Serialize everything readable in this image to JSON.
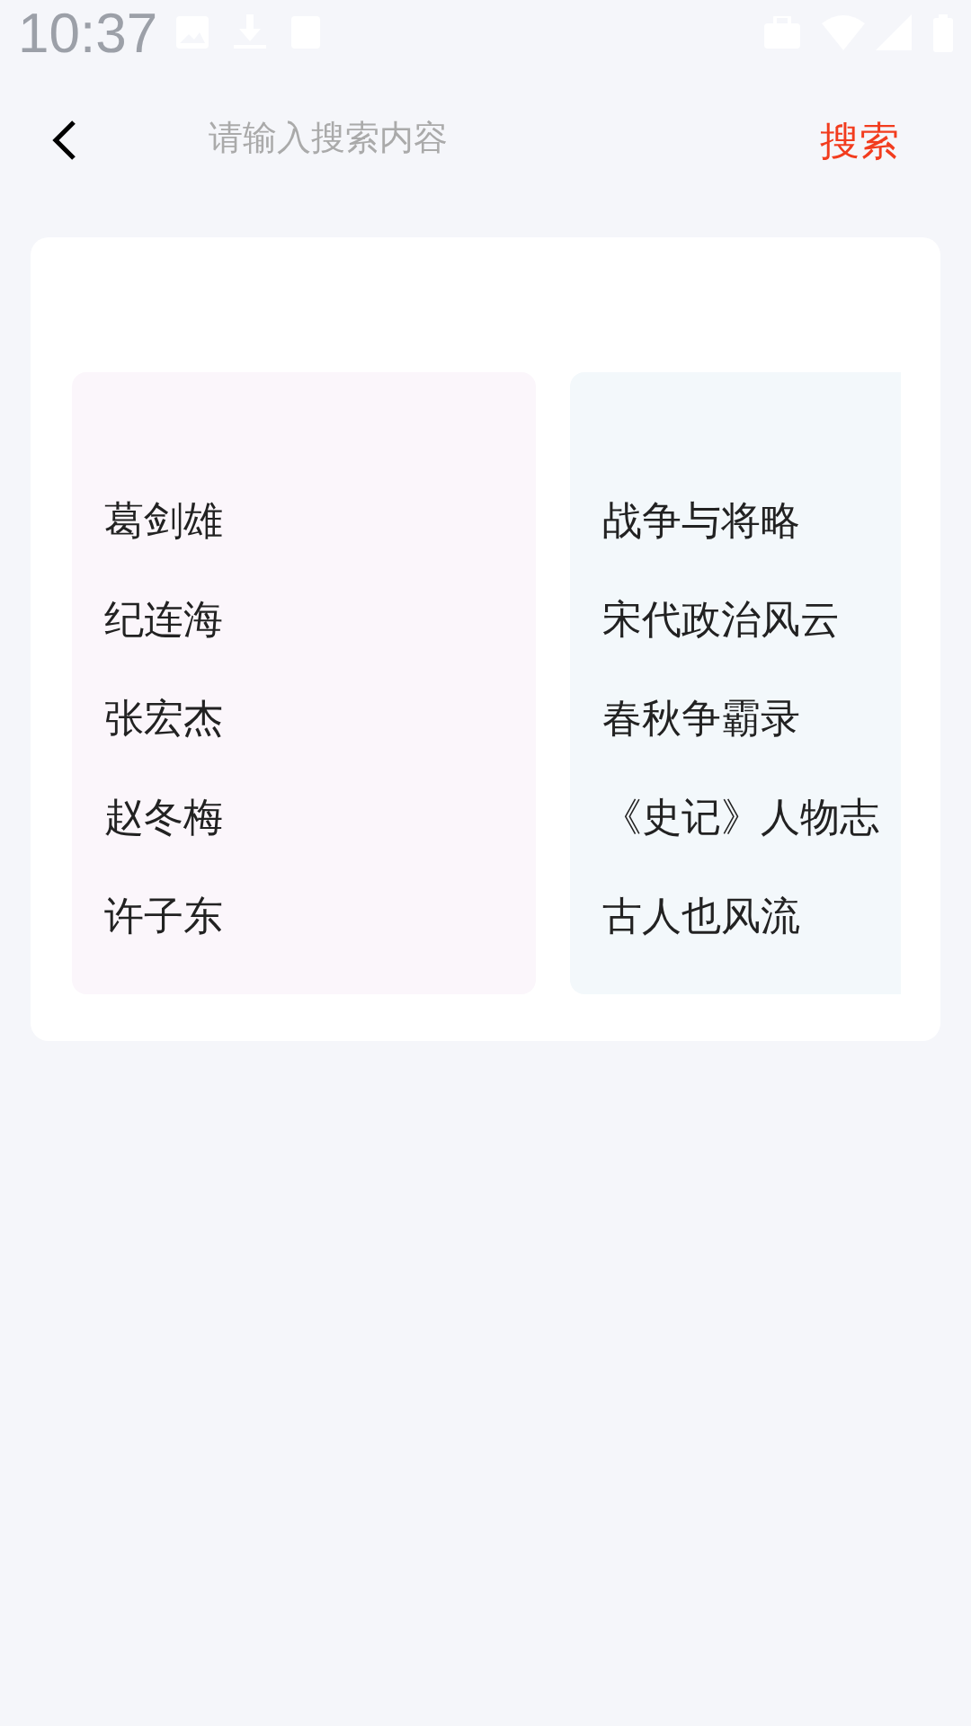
{
  "status_bar": {
    "time": "10:37"
  },
  "search": {
    "placeholder": "请输入搜索内容",
    "button": "搜索"
  },
  "lists": [
    {
      "color": "#fbf6fb",
      "items": [
        "葛剑雄",
        "纪连海",
        "张宏杰",
        "赵冬梅",
        "许子东"
      ]
    },
    {
      "color": "#f3f8fb",
      "items": [
        "战争与将略",
        "宋代政治风云",
        "春秋争霸录",
        "《史记》人物志",
        "古人也风流"
      ]
    }
  ]
}
